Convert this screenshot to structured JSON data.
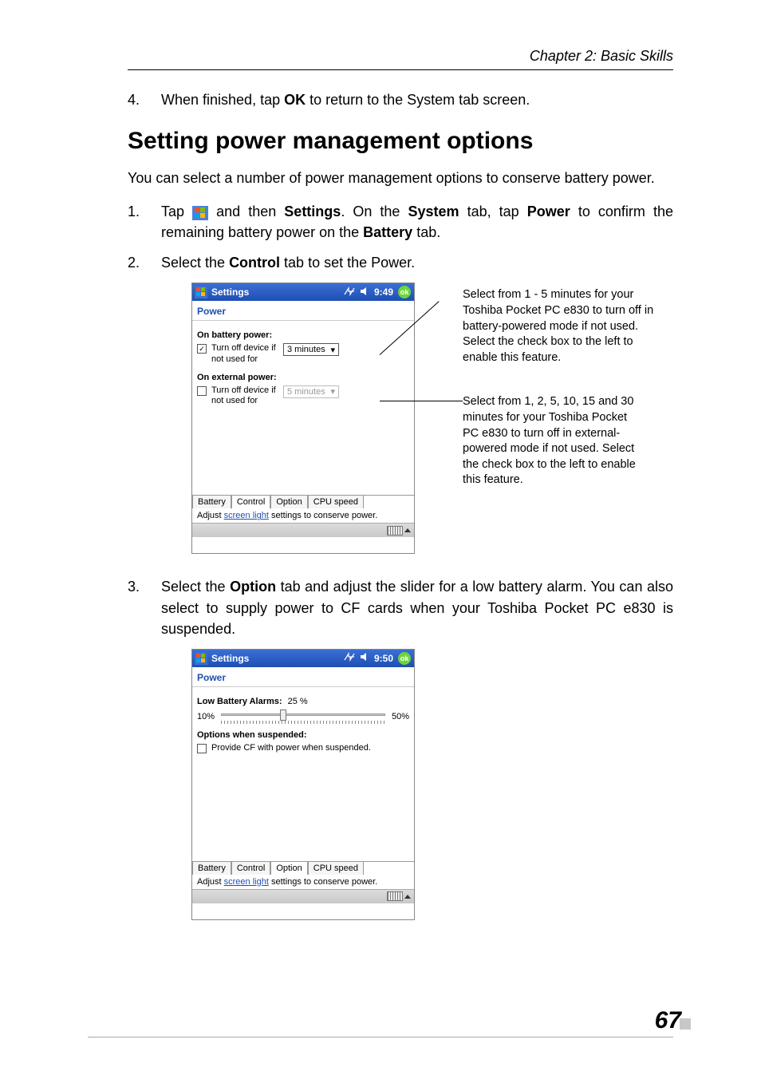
{
  "header": {
    "chapter": "Chapter 2: Basic Skills"
  },
  "step4": {
    "num": "4.",
    "text_before": "When finished, tap ",
    "bold1": "OK",
    "text_after": " to return to the System tab screen."
  },
  "heading": "Setting power management options",
  "intro": "You can select a number of power management options to conserve battery power.",
  "step1": {
    "num": "1.",
    "t1": "Tap ",
    "t2": " and then ",
    "b1": "Settings",
    "t3": ". On the ",
    "b2": "System",
    "t4": " tab, tap ",
    "b3": "Power",
    "t5": " to confirm the remaining battery power on the ",
    "b4": "Battery",
    "t6": " tab."
  },
  "step2": {
    "num": "2.",
    "t1": "Select the ",
    "b1": "Control",
    "t2": " tab to set the Power."
  },
  "pda1": {
    "top_title": "Settings",
    "time": "9:49",
    "ok": "ok",
    "subtitle": "Power",
    "section1": "On battery power:",
    "check1_text": "Turn off device if not used for",
    "dropdown1": "3 minutes",
    "section2": "On external power:",
    "check2_text": "Turn off device if not used for",
    "dropdown2": "5 minutes",
    "tabs": [
      "Battery",
      "Control",
      "Option",
      "CPU speed"
    ],
    "footer_before": "Adjust ",
    "footer_link": "screen light",
    "footer_after": " settings to conserve power."
  },
  "callout1": "Select from 1 - 5 minutes for your Toshiba Pocket PC e830 to turn off in battery-powered mode if not used. Select the check box to the left to enable this feature.",
  "callout2": "Select from 1, 2, 5, 10, 15 and 30 minutes for your Toshiba Pocket PC e830 to turn off in external-powered mode if not used. Select the check box to the left to enable this feature.",
  "step3": {
    "num": "3.",
    "t1": "Select the ",
    "b1": "Option",
    "t2": " tab and adjust the slider for a low battery alarm. You can also select to supply power to CF cards when your Toshiba Pocket PC e830 is suspended."
  },
  "pda2": {
    "top_title": "Settings",
    "time": "9:50",
    "ok": "ok",
    "subtitle": "Power",
    "alarm_label": "Low Battery Alarms:",
    "alarm_value": "25 %",
    "slider_min": "10%",
    "slider_max": "50%",
    "section": "Options when suspended:",
    "check_text": "Provide CF with power when suspended.",
    "tabs": [
      "Battery",
      "Control",
      "Option",
      "CPU speed"
    ],
    "footer_before": "Adjust ",
    "footer_link": "screen light",
    "footer_after": " settings to conserve power."
  },
  "page_number": "67"
}
